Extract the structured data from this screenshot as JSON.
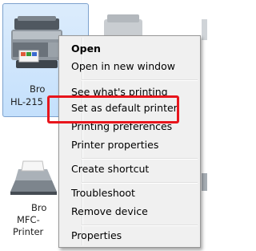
{
  "printers": [
    {
      "name_line1": "Bro",
      "name_line2": "HL-215",
      "selected": true
    },
    {
      "name_line1": "Bro",
      "name_line2": "MFC-",
      "name_line3": "Printer"
    }
  ],
  "context_menu": {
    "items": [
      {
        "label": "Open",
        "bold": true
      },
      {
        "label": "Open in new window"
      },
      {
        "label": "See what's printing"
      },
      {
        "label": "Set as default printer",
        "highlighted": true
      },
      {
        "label": "Printing preferences"
      },
      {
        "label": "Printer properties"
      },
      {
        "label": "Create shortcut"
      },
      {
        "label": "Troubleshoot"
      },
      {
        "label": "Remove device"
      },
      {
        "label": "Properties"
      }
    ]
  },
  "colors": {
    "highlight_border": "#e8151c",
    "selection_fill": "#c4e0fc",
    "menu_background": "#f0f0f0"
  }
}
